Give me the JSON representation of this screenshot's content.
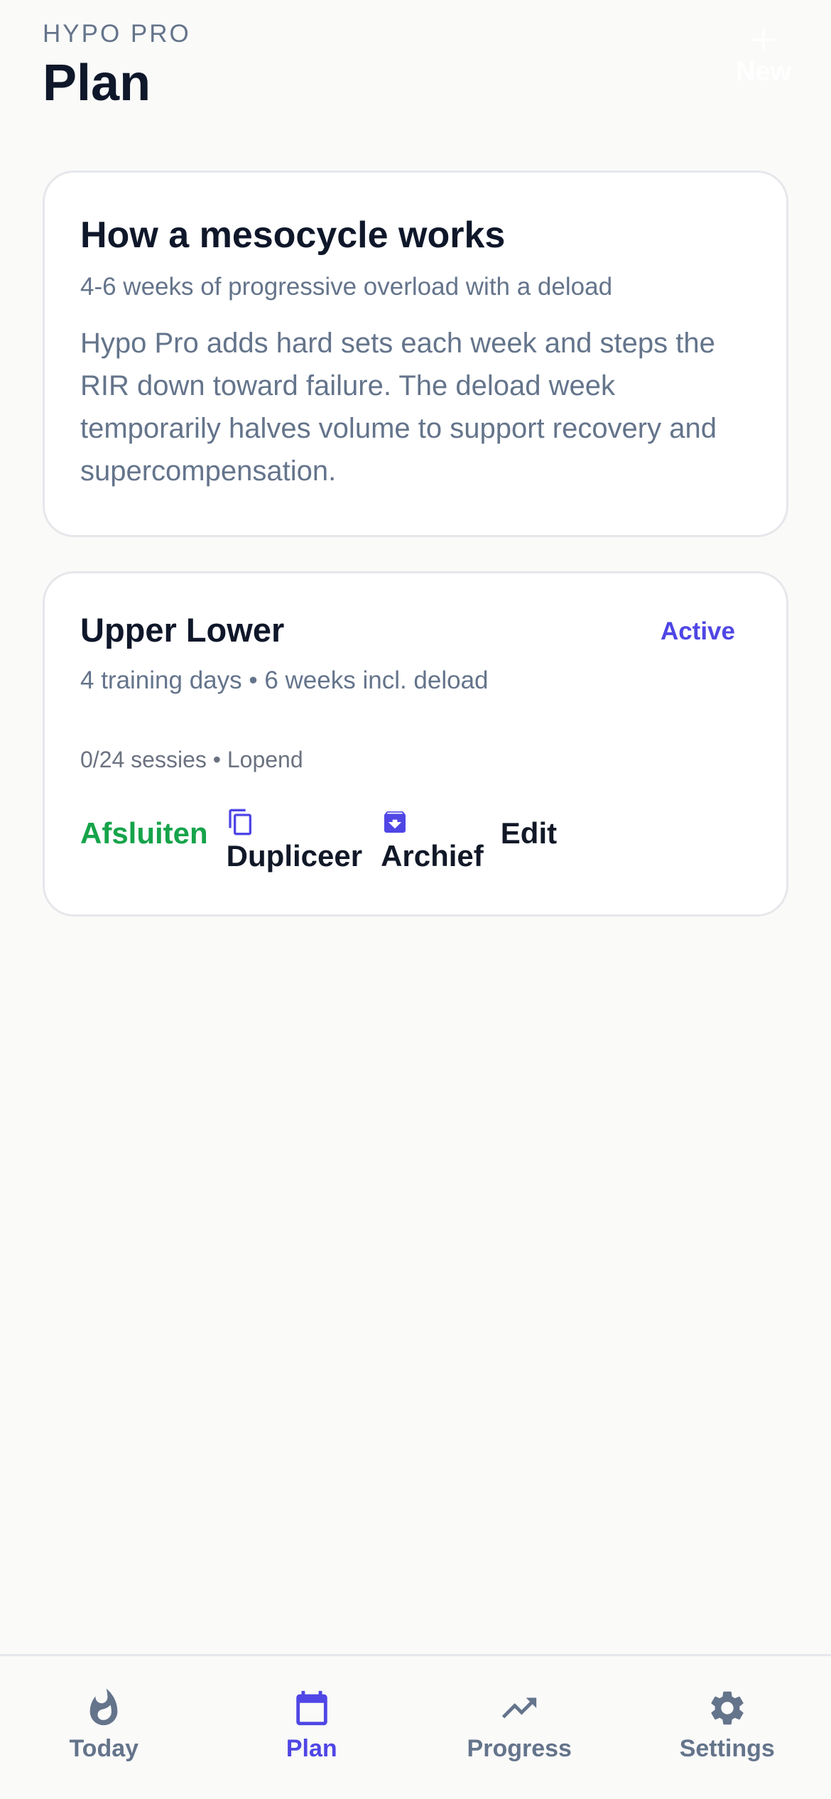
{
  "header": {
    "eyebrow": "HYPO PRO",
    "title": "Plan",
    "new_label": "New"
  },
  "info_card": {
    "title": "How a mesocycle works",
    "subtitle": "4-6 weeks of progressive overload with a deload",
    "body": "Hypo Pro adds hard sets each week and steps the RIR down toward failure. The deload week temporarily halves volume to support recovery and supercompensation."
  },
  "plan_card": {
    "title": "Upper Lower",
    "status": "Active",
    "meta": "4 training days • 6 weeks incl. deload",
    "sessions": "0/24 sessies • Lopend",
    "actions": {
      "finish_label": "Afsluiten",
      "duplicate_label": "Dupliceer",
      "archive_label": "Archief",
      "edit_label": "Edit"
    }
  },
  "bottom_nav": {
    "items": [
      {
        "label": "Today",
        "icon": "flame-icon",
        "active": false
      },
      {
        "label": "Plan",
        "icon": "calendar-icon",
        "active": true
      },
      {
        "label": "Progress",
        "icon": "trending-up-icon",
        "active": false
      },
      {
        "label": "Settings",
        "icon": "gear-icon",
        "active": false
      }
    ]
  },
  "colors": {
    "accent": "#4F46E5",
    "success": "#16A34A",
    "muted": "#64748B",
    "background": "#FAFAF9"
  }
}
